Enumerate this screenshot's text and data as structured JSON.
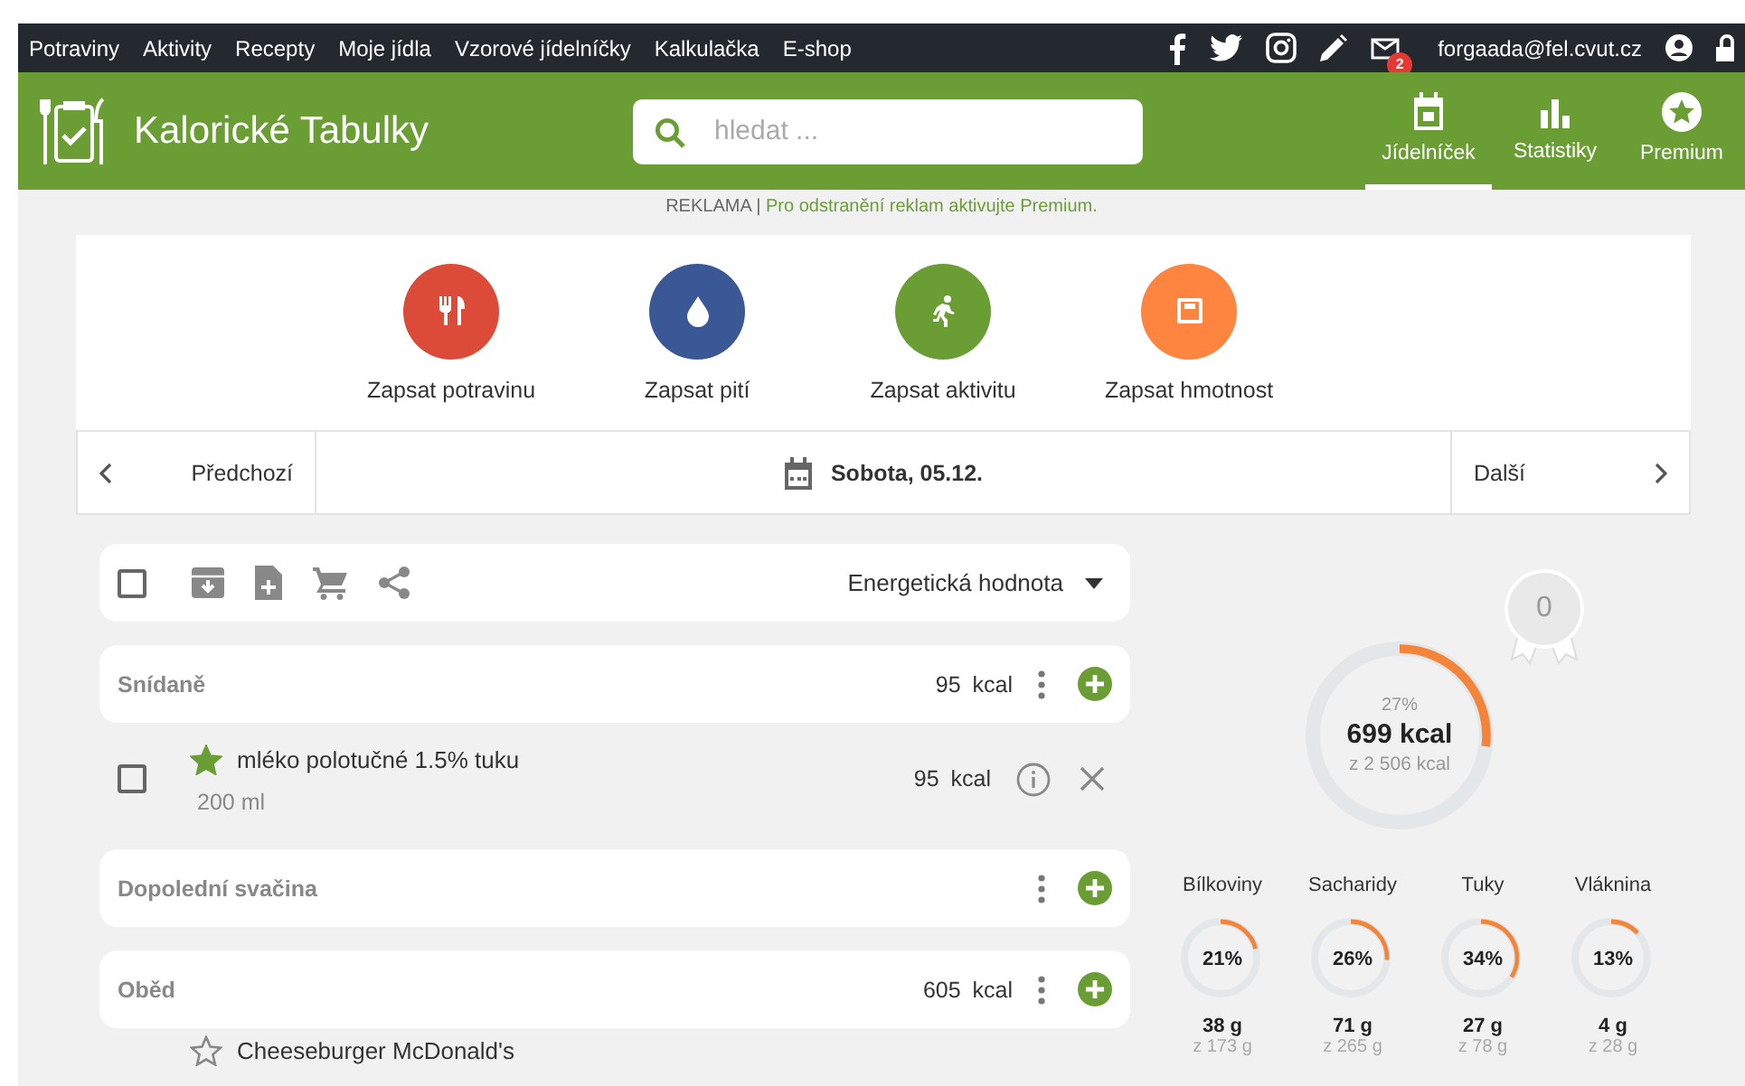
{
  "top_nav": {
    "links": [
      "Potraviny",
      "Aktivity",
      "Recepty",
      "Moje jídla",
      "Vzorové jídelníčky",
      "Kalkulačka",
      "E-shop"
    ],
    "mail_badge": "2",
    "user_email": "forgaada@fel.cvut.cz"
  },
  "header": {
    "logo_text": "Kalorické Tabulky",
    "search": {
      "placeholder": "hledat ..."
    },
    "tabs": [
      {
        "label": "Jídelníček",
        "kind": "calendar",
        "selected": true
      },
      {
        "label": "Statistiky",
        "kind": "chart",
        "selected": false
      },
      {
        "label": "Premium",
        "kind": "star",
        "selected": false
      }
    ]
  },
  "ad_notice": {
    "label": "REKLAMA",
    "separator": "|",
    "message": "Pro odstranění reklam aktivujte Premium."
  },
  "quick_actions": [
    {
      "label": "Zapsat potravinu",
      "kind": "food",
      "color": "#dc4a38"
    },
    {
      "label": "Zapsat pití",
      "kind": "drink",
      "color": "#3a5796"
    },
    {
      "label": "Zapsat aktivitu",
      "kind": "activity",
      "color": "#6a9e35"
    },
    {
      "label": "Zapsat hmotnost",
      "kind": "weight",
      "color": "#fd8540"
    }
  ],
  "date_nav": {
    "previous": "Předchozí",
    "date": "Sobota, 05.12.",
    "next": "Další"
  },
  "diary": {
    "toolbar": {
      "select_all_checked": false,
      "nutrient_select": "Energetická hodnota"
    },
    "meals": [
      {
        "name": "Snídaně",
        "total": "95",
        "unit": "kcal",
        "items": [
          {
            "name": "mléko polotučné 1.5% tuku",
            "amount": "200 ml",
            "energy": "95",
            "unit": "kcal",
            "favorite": true,
            "checked": false
          }
        ]
      },
      {
        "name": "Dopolední svačina"
      },
      {
        "name": "Oběd",
        "total": "605",
        "unit": "kcal",
        "items": [
          {
            "name": "Cheeseburger McDonald's",
            "favorite": false
          }
        ]
      }
    ]
  },
  "summary": {
    "badge": "0",
    "percent": "27%",
    "consumed": "699 kcal",
    "goal": "z 2 506 kcal",
    "macros": [
      {
        "name": "Bílkoviny",
        "percent": "21%",
        "amount": "38 g",
        "goal": "z 173 g"
      },
      {
        "name": "Sacharidy",
        "percent": "26%",
        "amount": "71 g",
        "goal": "z 265 g"
      },
      {
        "name": "Tuky",
        "percent": "34%",
        "amount": "27 g",
        "goal": "z 78 g"
      },
      {
        "name": "Vláknina",
        "percent": "13%",
        "amount": "4 g",
        "goal": "z 28 g"
      }
    ]
  }
}
